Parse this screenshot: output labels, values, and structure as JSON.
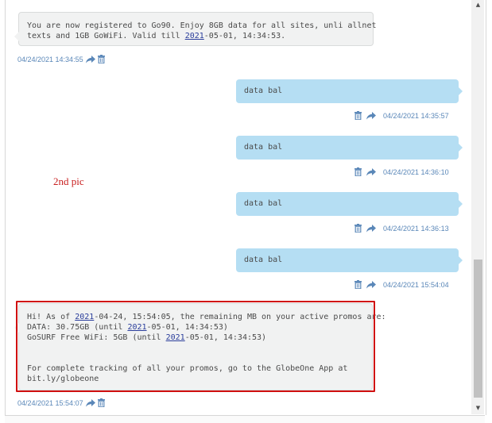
{
  "messages": [
    {
      "direction": "in",
      "lines": [
        [
          {
            "t": "You are now registered to Go90. Enjoy 8GB data for all sites, unli allnet"
          }
        ],
        [
          {
            "t": "texts and 1GB GoWiFi. Valid till "
          },
          {
            "t": "2021",
            "link": true
          },
          {
            "t": "-05-01, 14:34:53."
          }
        ]
      ],
      "time": "04/24/2021 14:34:55"
    },
    {
      "direction": "out",
      "text": "data bal",
      "time": "04/24/2021 14:35:57"
    },
    {
      "direction": "out",
      "text": "data bal",
      "time": "04/24/2021 14:36:10"
    },
    {
      "direction": "out",
      "text": "data bal",
      "time": "04/24/2021 14:36:13"
    },
    {
      "direction": "out",
      "text": "data bal",
      "time": "04/24/2021 15:54:04"
    },
    {
      "direction": "in",
      "lines": [
        [
          {
            "t": "Hi! As of "
          },
          {
            "t": "2021",
            "link": true
          },
          {
            "t": "-04-24, 15:54:05, the remaining MB on your active promos are:"
          }
        ],
        [
          {
            "t": "DATA: 30.75GB (until "
          },
          {
            "t": "2021",
            "link": true
          },
          {
            "t": "-05-01, 14:34:53)"
          }
        ],
        [
          {
            "t": "GoSURF Free WiFi: 5GB (until "
          },
          {
            "t": "2021",
            "link": true
          },
          {
            "t": "-05-01, 14:34:53)"
          }
        ],
        [
          {
            "t": " "
          }
        ],
        [
          {
            "t": " "
          }
        ],
        [
          {
            "t": "For complete tracking of all your promos, go to the GlobeOne App at"
          }
        ],
        [
          {
            "t": "bit.ly/globeone"
          }
        ]
      ],
      "time": "04/24/2021 15:54:07"
    }
  ],
  "annotation": "2nd pic",
  "colors": {
    "incoming": "#f1f2f2",
    "outgoing": "#b5def3",
    "timestamp": "#5a87b8",
    "highlight": "#d01010",
    "annotation": "#c81e1e"
  },
  "icons": {
    "delete": "trash-icon",
    "forward": "forward-arrow-icon",
    "scroll_up": "scroll-up-arrow-icon",
    "scroll_down": "scroll-down-arrow-icon"
  }
}
